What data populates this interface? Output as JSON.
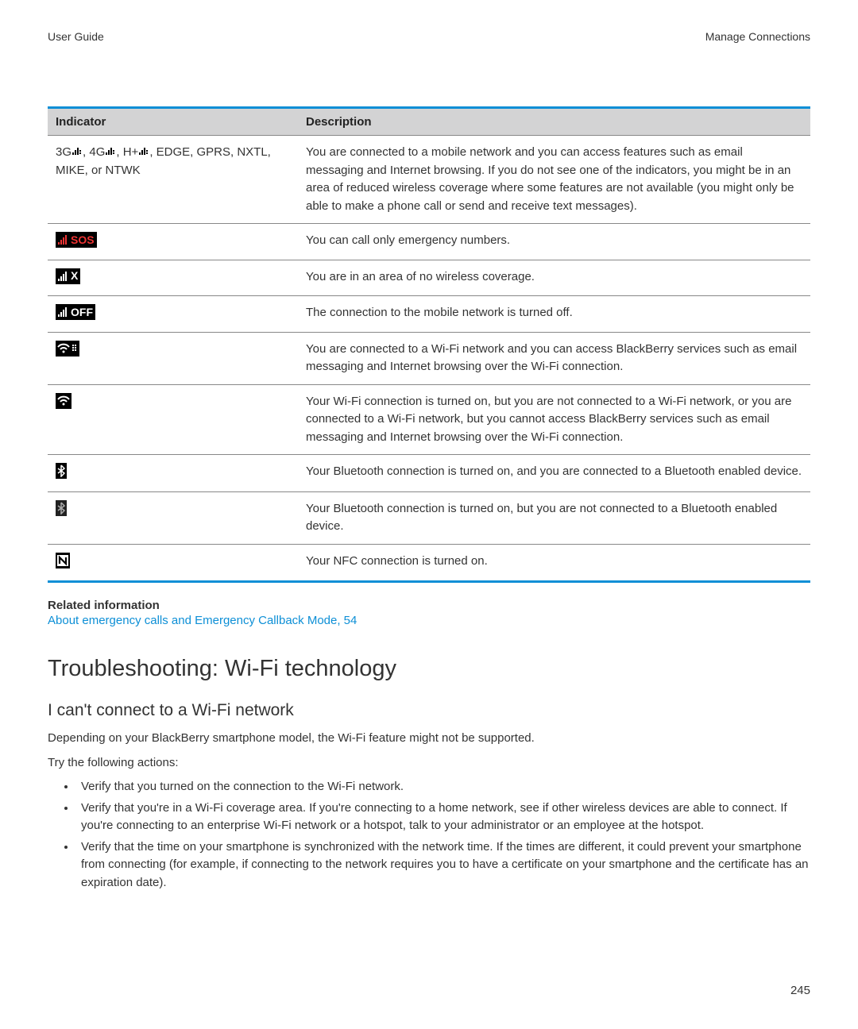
{
  "header": {
    "left": "User Guide",
    "right": "Manage Connections"
  },
  "table": {
    "headers": {
      "indicator": "Indicator",
      "description": "Description"
    },
    "rows": [
      {
        "icon_type": "network_labels",
        "prefix_groups": [
          "3G",
          "4G",
          "H+"
        ],
        "suffix_text": ", EDGE, GPRS, NXTL, MIKE, or NTWK",
        "description": "You are connected to a mobile network and you can access features such as email messaging and Internet browsing. If you do not see one of the indicators, you might be in an area of reduced wireless coverage where some features are not available (you might only be able to make a phone call or send and receive text messages)."
      },
      {
        "icon_type": "signal_sos",
        "icon_text": "SOS",
        "description": "You can call only emergency numbers."
      },
      {
        "icon_type": "signal_x",
        "icon_text": "X",
        "description": "You are in an area of no wireless coverage."
      },
      {
        "icon_type": "signal_off",
        "icon_text": "OFF",
        "description": "The connection to the mobile network is turned off."
      },
      {
        "icon_type": "wifi_connected",
        "description": "You are connected to a Wi-Fi network and you can access BlackBerry services such as email messaging and Internet browsing over the Wi-Fi connection."
      },
      {
        "icon_type": "wifi_on",
        "description": "Your Wi-Fi connection is turned on, but you are not connected to a Wi-Fi network, or you are connected to a Wi-Fi network, but you cannot access BlackBerry services such as email messaging and Internet browsing over the Wi-Fi connection."
      },
      {
        "icon_type": "bluetooth_connected",
        "description": "Your Bluetooth connection is turned on, and you are connected to a Bluetooth enabled device."
      },
      {
        "icon_type": "bluetooth_on",
        "description": "Your Bluetooth connection is turned on, but you are not connected to a Bluetooth enabled device."
      },
      {
        "icon_type": "nfc",
        "icon_text": "N",
        "description": "Your NFC connection is turned on."
      }
    ]
  },
  "related": {
    "heading": "Related information",
    "link": "About emergency calls and Emergency Callback Mode, 54"
  },
  "troubleshooting": {
    "title": "Troubleshooting: Wi-Fi technology",
    "subtitle": "I can't connect to a Wi-Fi network",
    "para1": "Depending on your BlackBerry smartphone model, the Wi-Fi feature might not be supported.",
    "para2": "Try the following actions:",
    "bullets": [
      "Verify that you turned on the connection to the Wi-Fi network.",
      "Verify that you're in a Wi-Fi coverage area. If you're connecting to a home network, see if other wireless devices are able to connect. If you're connecting to an enterprise Wi-Fi network or a hotspot, talk to your administrator or an employee at the hotspot.",
      "Verify that the time on your smartphone is synchronized with the network time. If the times are different, it could prevent your smartphone from connecting (for example, if connecting to the network requires you to have a certificate on your smartphone and the certificate has an expiration date)."
    ]
  },
  "page_number": "245"
}
